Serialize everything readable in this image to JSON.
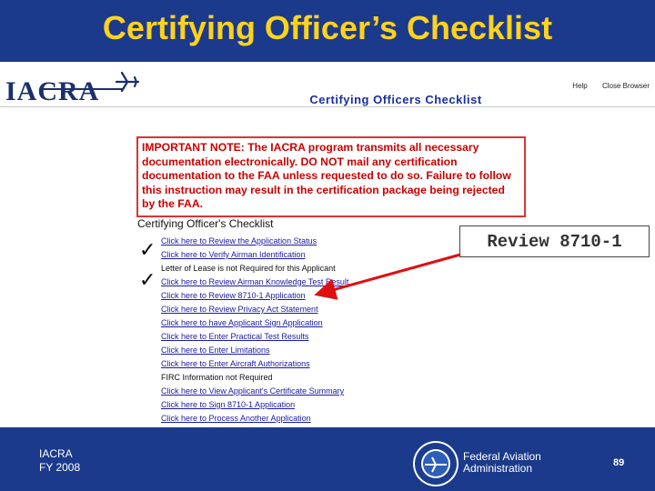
{
  "slide": {
    "title": "Certifying Officer’s Checklist",
    "footer_line1": "IACRA",
    "footer_line2": "FY 2008",
    "agency_line1": "Federal Aviation",
    "agency_line2": "Administration",
    "page_number": "89"
  },
  "app": {
    "logo_text": "IACRA",
    "logo_icon": "airplane-icon",
    "nav": {
      "help": "Help",
      "close": "Close Browser"
    },
    "page_heading": "Certifying Officers Checklist",
    "important_note": "IMPORTANT NOTE: The IACRA program transmits all necessary documentation electronically. DO NOT mail any certification documentation to the FAA unless requested to do so. Failure to follow this instruction may result in the certification package being rejected by the FAA.",
    "checklist_title": "Certifying Officer's Checklist",
    "items": [
      {
        "label": "Click here to Review the Application Status",
        "link": true
      },
      {
        "label": "Click here to Verify Airman Identification",
        "link": true
      },
      {
        "label": "Letter of Lease is not Required for this Applicant",
        "link": false
      },
      {
        "label": "Click here to Review Airman Knowledge Test Result",
        "link": true
      },
      {
        "label": "Click here to Review 8710-1 Application",
        "link": true
      },
      {
        "label": "Click here to Review Privacy Act Statement",
        "link": true
      },
      {
        "label": "Click here to have Applicant Sign Application",
        "link": true
      },
      {
        "label": "Click here to Enter Practical Test Results",
        "link": true
      },
      {
        "label": "Click here to Enter Limitations",
        "link": true
      },
      {
        "label": "Click here to Enter Aircraft Authorizations",
        "link": true
      },
      {
        "label": "FIRC Information not Required",
        "link": false
      },
      {
        "label": "Click here to View Applicant's Certificate Summary",
        "link": true
      },
      {
        "label": "Click here to Sign 8710-1 Application",
        "link": true
      },
      {
        "label": "Click here to Process Another Application",
        "link": true
      }
    ],
    "check_mark": "✓",
    "callout": "Review 8710-1"
  },
  "colors": {
    "slide_background": "#1b3a8c",
    "title": "#ffd21e",
    "note_text": "#cc0000",
    "link": "#1a1aa6",
    "arrow": "#e01010"
  }
}
